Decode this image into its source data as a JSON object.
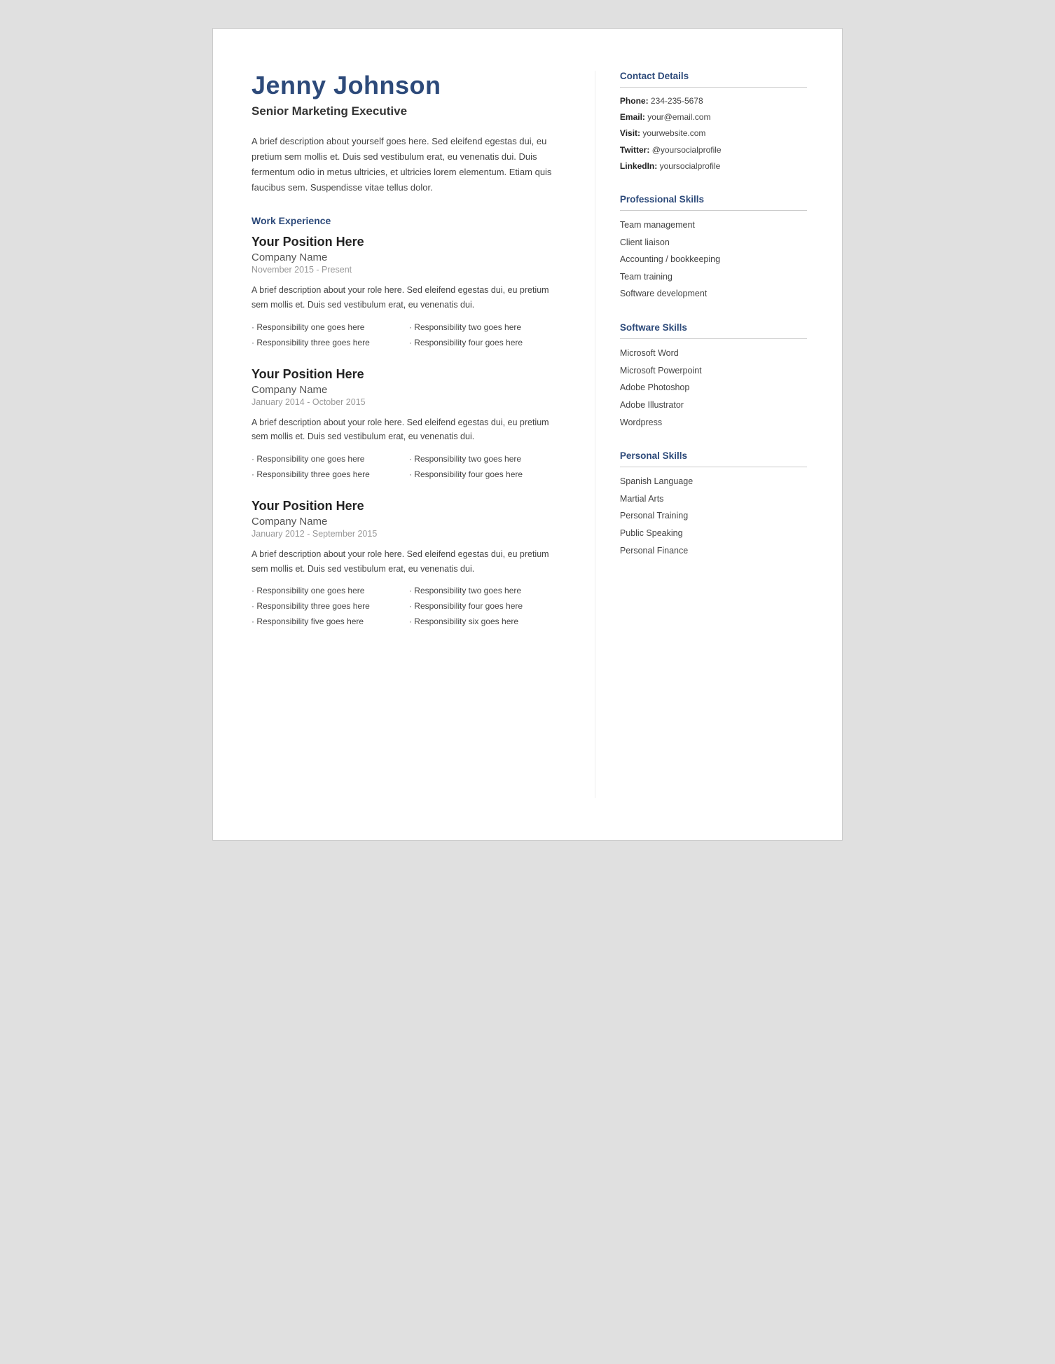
{
  "header": {
    "name": "Jenny Johnson",
    "title": "Senior Marketing Executive"
  },
  "summary": "A brief description about yourself goes here. Sed eleifend egestas dui, eu pretium sem mollis et. Duis sed vestibulum erat, eu venenatis dui. Duis fermentum odio in metus ultricies, et ultricies lorem elementum. Etiam quis faucibus sem. Suspendisse vitae tellus dolor.",
  "work_experience": {
    "heading": "Work Experience",
    "jobs": [
      {
        "position": "Your Position Here",
        "company": "Company Name",
        "dates": "November 2015 - Present",
        "description": "A brief description about your role here. Sed eleifend egestas dui, eu pretium sem mollis et. Duis sed vestibulum erat, eu venenatis dui.",
        "responsibilities": [
          "Responsibility one goes here",
          "Responsibility two goes here",
          "Responsibility three goes here",
          "Responsibility four goes here"
        ]
      },
      {
        "position": "Your Position Here",
        "company": "Company Name",
        "dates": "January 2014 - October 2015",
        "description": "A brief description about your role here. Sed eleifend egestas dui, eu pretium sem mollis et. Duis sed vestibulum erat, eu venenatis dui.",
        "responsibilities": [
          "Responsibility one goes here",
          "Responsibility two goes here",
          "Responsibility three goes here",
          "Responsibility four goes here"
        ]
      },
      {
        "position": "Your Position Here",
        "company": "Company Name",
        "dates": "January 2012 - September 2015",
        "description": "A brief description about your role here. Sed eleifend egestas dui, eu pretium sem mollis et. Duis sed vestibulum erat, eu venenatis dui.",
        "responsibilities": [
          "Responsibility one goes here",
          "Responsibility two goes here",
          "Responsibility three goes here",
          "Responsibility four goes here",
          "Responsibility five goes here",
          "Responsibility six goes here"
        ]
      }
    ]
  },
  "contact": {
    "heading": "Contact Details",
    "items": [
      {
        "label": "Phone:",
        "value": "234-235-5678"
      },
      {
        "label": "Email:",
        "value": "your@email.com"
      },
      {
        "label": "Visit:",
        "value": "yourwebsite.com"
      },
      {
        "label": "Twitter:",
        "value": "@yoursocialprofile"
      },
      {
        "label": "LinkedIn:",
        "value": "yoursocialprofile"
      }
    ]
  },
  "professional_skills": {
    "heading": "Professional Skills",
    "items": [
      "Team management",
      "Client liaison",
      "Accounting / bookkeeping",
      "Team training",
      "Software development"
    ]
  },
  "software_skills": {
    "heading": "Software Skills",
    "items": [
      "Microsoft Word",
      "Microsoft Powerpoint",
      "Adobe Photoshop",
      "Adobe Illustrator",
      "Wordpress"
    ]
  },
  "personal_skills": {
    "heading": "Personal Skills",
    "items": [
      "Spanish Language",
      "Martial Arts",
      "Personal Training",
      "Public Speaking",
      "Personal Finance"
    ]
  }
}
